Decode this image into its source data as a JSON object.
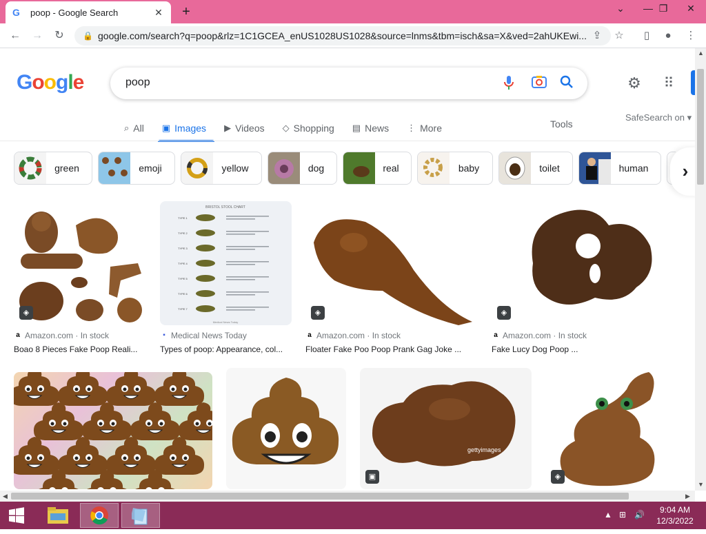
{
  "browser": {
    "tab_title": "poop - Google Search",
    "tab_favicon": "G",
    "url": "google.com/search?q=poop&rlz=1C1GCEA_enUS1028US1028&source=lnms&tbm=isch&sa=X&ved=2ahUKEwi...",
    "accent_color": "#e8699a"
  },
  "header": {
    "logo_text": [
      "G",
      "o",
      "o",
      "g",
      "l",
      "e"
    ],
    "query": "poop"
  },
  "tabs": [
    {
      "label": "All",
      "icon": "search-icon"
    },
    {
      "label": "Images",
      "icon": "image-icon"
    },
    {
      "label": "Videos",
      "icon": "play-icon"
    },
    {
      "label": "Shopping",
      "icon": "tag-icon"
    },
    {
      "label": "News",
      "icon": "news-icon"
    },
    {
      "label": "More",
      "icon": "more-icon"
    }
  ],
  "tools_label": "Tools",
  "safesearch_label": "SafeSearch on",
  "chips": [
    "green",
    "emoji",
    "yellow",
    "dog",
    "real",
    "baby",
    "toilet",
    "human"
  ],
  "results": [
    {
      "source": "Amazon.com · In stock",
      "title": "Boao 8 Pieces Fake Poop Reali..."
    },
    {
      "source": "Medical News Today",
      "title": "Types of poop: Appearance, col..."
    },
    {
      "source": "Amazon.com · In stock",
      "title": "Floater Fake Poo Poop Prank Gag Joke ..."
    },
    {
      "source": "Amazon.com · In stock",
      "title": "Fake Lucy Dog Poop ..."
    }
  ],
  "stool_chart": {
    "title": "BRISTOL STOOL CHART",
    "rows": [
      "TYPE 1",
      "TYPE 2",
      "TYPE 3",
      "TYPE 4",
      "TYPE 5",
      "TYPE 6",
      "TYPE 7"
    ],
    "footer": "Medical News Today"
  },
  "watermark": "gettyimages",
  "taskbar": {
    "time": "9:04 AM",
    "date": "12/3/2022"
  }
}
